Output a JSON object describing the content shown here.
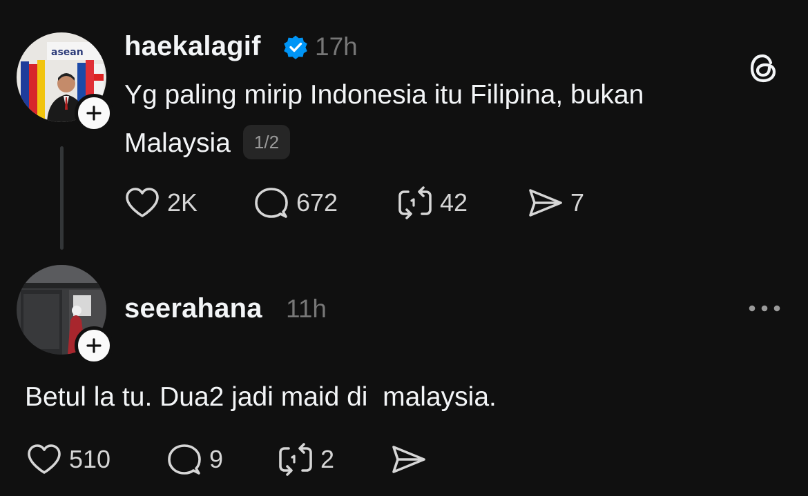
{
  "post": {
    "username": "haekalagif",
    "verified": true,
    "time": "17h",
    "text_line1": "Yg paling mirip Indonesia itu Filipina, bukan",
    "text_line2": "Malaysia",
    "page_indicator": "1/2",
    "actions": {
      "likes": "2K",
      "replies": "672",
      "reposts": "42",
      "shares": "7"
    },
    "avatar_sign": "asean"
  },
  "reply": {
    "username": "seerahana",
    "time": "11h",
    "text": "Betul la tu. Dua2 jadi maid di  malaysia.",
    "actions": {
      "likes": "510",
      "replies": "9",
      "reposts": "2"
    }
  },
  "icons": {
    "threads_logo": "threads-logo-icon",
    "more": "more-options-icon",
    "heart": "heart-icon",
    "comment": "comment-icon",
    "repost": "repost-icon",
    "share": "share-icon",
    "follow": "plus-icon",
    "verified": "verified-badge-icon"
  },
  "colors": {
    "background": "#101010",
    "text": "#f3f5f7",
    "muted": "#777777",
    "verified_blue": "#0095f6"
  }
}
